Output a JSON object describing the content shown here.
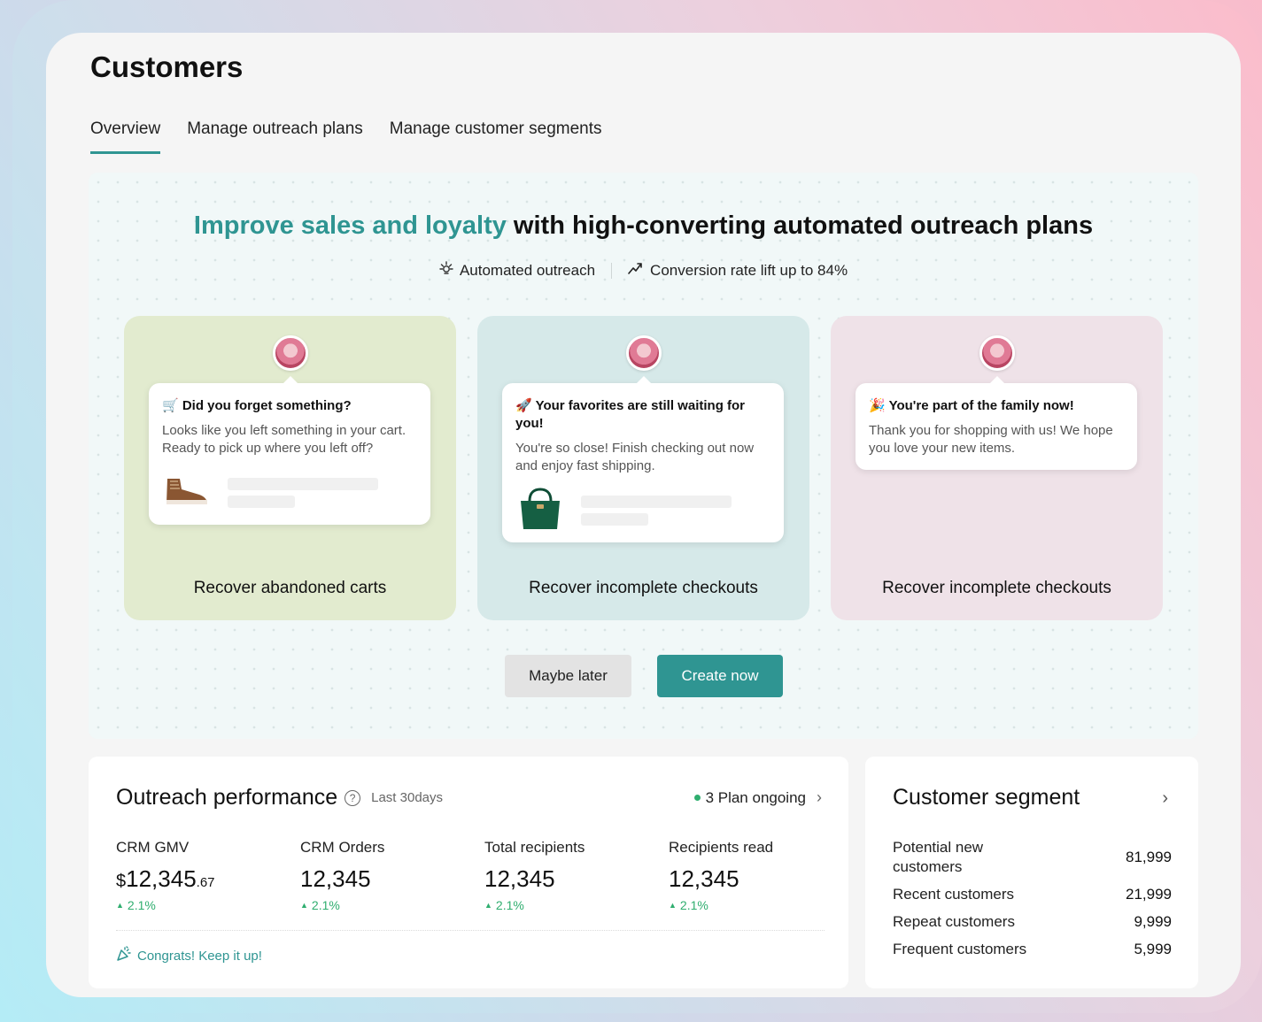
{
  "page": {
    "title": "Customers"
  },
  "tabs": [
    {
      "label": "Overview",
      "active": true
    },
    {
      "label": "Manage outreach plans",
      "active": false
    },
    {
      "label": "Manage customer segments",
      "active": false
    }
  ],
  "hero": {
    "heading_accent": "Improve sales and loyalty",
    "heading_rest": " with high-converting automated outreach plans",
    "features": [
      {
        "icon": "automation-icon",
        "label": "Automated outreach"
      },
      {
        "icon": "trend-up-icon",
        "label": "Conversion rate lift up to 84%"
      }
    ],
    "cards": [
      {
        "bubble_title": "🛒 Did you forget something?",
        "bubble_text": "Looks like you left something in your cart. Ready to pick up where you left off?",
        "product_icon": "shoe-icon",
        "label": "Recover abandoned carts",
        "color": "#e2ebcf"
      },
      {
        "bubble_title": "🚀 Your favorites are still waiting for you!",
        "bubble_text": "You're so close! Finish checking out now and enjoy fast shipping.",
        "product_icon": "handbag-icon",
        "label": "Recover incomplete checkouts",
        "color": "#d6e9e9"
      },
      {
        "bubble_title": "🎉 You're part of the family now!",
        "bubble_text": "Thank you for shopping with us! We hope you love your new items.",
        "label": "Recover incomplete checkouts",
        "color": "#efe2e8"
      }
    ],
    "buttons": {
      "secondary": "Maybe later",
      "primary": "Create now"
    }
  },
  "performance": {
    "title": "Outreach performance",
    "period": "Last 30days",
    "ongoing": "3 Plan ongoing",
    "metrics": [
      {
        "label": "CRM GMV",
        "currency": "$",
        "value": "12,345",
        "decimal": ".67",
        "delta": "2.1%"
      },
      {
        "label": "CRM Orders",
        "value": "12,345",
        "delta": "2.1%"
      },
      {
        "label": "Total recipients",
        "value": "12,345",
        "delta": "2.1%"
      },
      {
        "label": "Recipients read",
        "value": "12,345",
        "delta": "2.1%"
      }
    ],
    "congrats": "Congrats! Keep it up!"
  },
  "segment": {
    "title": "Customer segment",
    "rows": [
      {
        "name": "Potential new customers",
        "value": "81,999"
      },
      {
        "name": "Recent customers",
        "value": "21,999"
      },
      {
        "name": "Repeat customers",
        "value": "9,999"
      },
      {
        "name": "Frequent customers",
        "value": "5,999"
      }
    ]
  },
  "colors": {
    "accent": "#2f9592",
    "positive": "#2fae6f"
  }
}
